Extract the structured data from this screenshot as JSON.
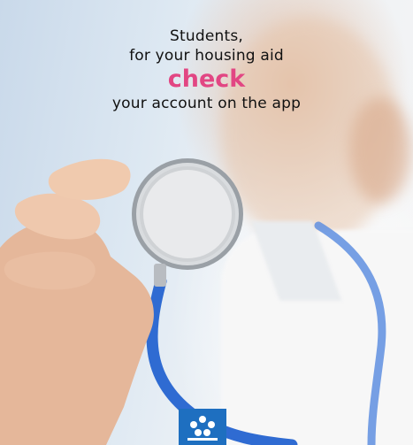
{
  "headline": {
    "line1": "Students,",
    "line2": "for your housing aid",
    "highlight": "check",
    "line3": "your account on the app"
  },
  "colors": {
    "highlight": "#e24683",
    "logo": "#1e6fc0",
    "tubing": "#2f6bd2"
  },
  "logo": {
    "icon": "caf-logo-icon"
  }
}
